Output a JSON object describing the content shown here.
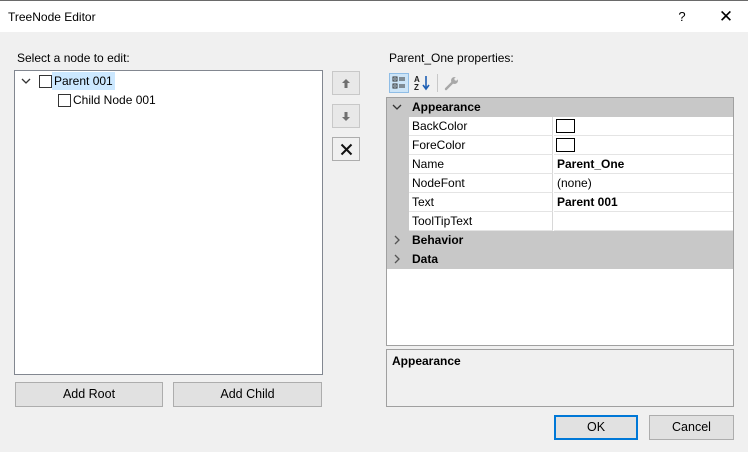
{
  "window": {
    "title": "TreeNode Editor",
    "help_glyph": "?",
    "close_glyph": "✕"
  },
  "left": {
    "label": "Select a node to edit:",
    "tree": [
      {
        "text": "Parent 001",
        "level": 0,
        "expanded": true,
        "selected": true,
        "checked": false
      },
      {
        "text": "Child Node 001",
        "level": 1,
        "expanded": false,
        "selected": false,
        "checked": false
      }
    ],
    "add_root_label": "Add Root",
    "add_child_label": "Add Child"
  },
  "right": {
    "label": "Parent_One properties:",
    "categories": [
      {
        "name": "Appearance",
        "expanded": true,
        "properties": [
          {
            "name": "BackColor",
            "value": "",
            "swatch": "#ffffff"
          },
          {
            "name": "ForeColor",
            "value": "",
            "swatch": "#ffffff"
          },
          {
            "name": "Name",
            "value": "Parent_One",
            "bold": true
          },
          {
            "name": "NodeFont",
            "value": "(none)"
          },
          {
            "name": "Text",
            "value": "Parent 001",
            "bold": true
          },
          {
            "name": "ToolTipText",
            "value": ""
          }
        ]
      },
      {
        "name": "Behavior",
        "expanded": false
      },
      {
        "name": "Data",
        "expanded": false
      }
    ],
    "description_title": "Appearance"
  },
  "footer": {
    "ok_label": "OK",
    "cancel_label": "Cancel"
  },
  "colors": {
    "accent": "#0078d7",
    "selection": "#cce8ff",
    "category_band": "#c8c8c8"
  }
}
